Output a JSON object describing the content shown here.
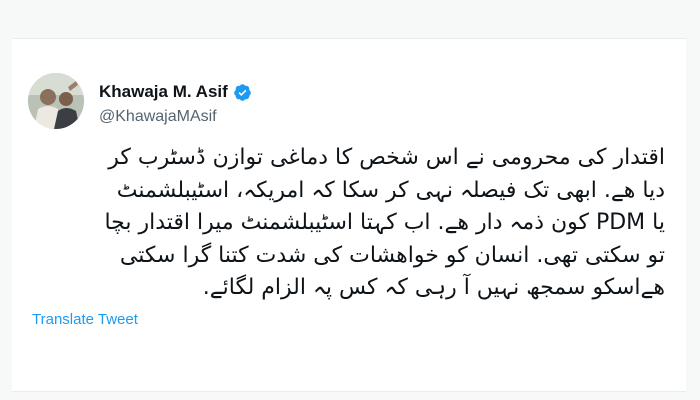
{
  "tweet": {
    "author": {
      "display_name": "Khawaja M. Asif",
      "handle": "@KhawajaMAsif",
      "verified": true
    },
    "text_lines": [
      "اقتدار کی محرومی نے اس شخص کا دماغی توازن ڈسٹرب کر",
      "دیا ھے. ابھی تک فیصلہ نہی کر سکا کہ امریکہ، اسٹیبلشمنٹ",
      "یا PDM کون ذمہ دار ھے. اب کہتا اسٹیبلشمنٹ میرا اقتدار بچا",
      "تو سکتی تھی. انسان کو خواھشات کی شدت کتنا گرا سکتی",
      "ھےاسکو سمجھ نہیں آ رہی کہ کس پہ الزام لگائے."
    ],
    "translate_label": "Translate Tweet"
  },
  "colors": {
    "verified_badge": "#1d9bf0",
    "link": "#1d9bf0",
    "secondary_text": "#536471"
  }
}
